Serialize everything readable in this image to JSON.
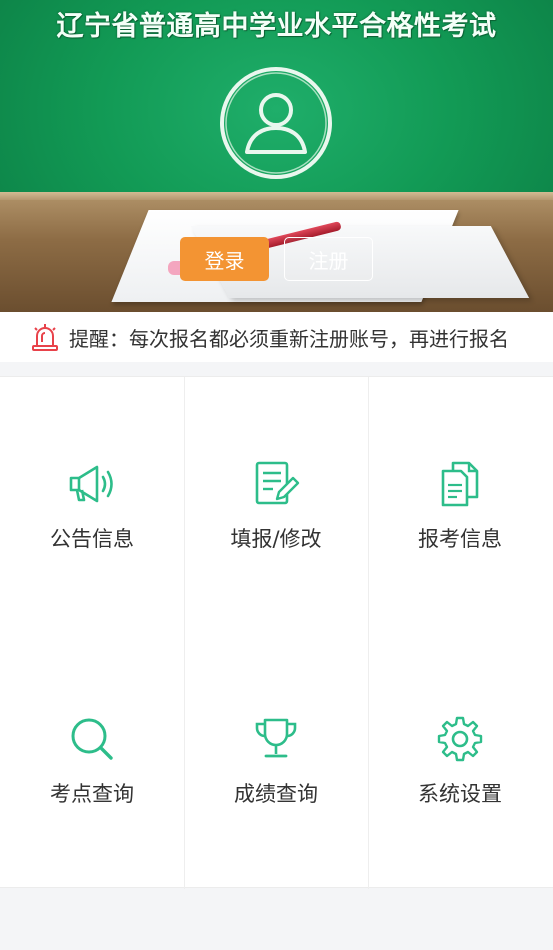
{
  "banner": {
    "title": "辽宁省普通高中学业水平合格性考试",
    "avatar_icon": "user-avatar-icon",
    "login_label": "登录",
    "register_label": "注册"
  },
  "notice": {
    "icon": "alarm-icon",
    "text": "提醒：每次报名都必须重新注册账号，再进行报名"
  },
  "menu": {
    "items": [
      {
        "label": "公告信息",
        "icon": "megaphone-icon"
      },
      {
        "label": "填报/修改",
        "icon": "edit-document-icon"
      },
      {
        "label": "报考信息",
        "icon": "documents-icon"
      },
      {
        "label": "考点查询",
        "icon": "search-icon"
      },
      {
        "label": "成绩查询",
        "icon": "trophy-icon"
      },
      {
        "label": "系统设置",
        "icon": "gear-icon"
      }
    ]
  },
  "colors": {
    "accent_green": "#2dbd8a",
    "login_orange": "#f39433",
    "alarm_red": "#e8424a"
  }
}
